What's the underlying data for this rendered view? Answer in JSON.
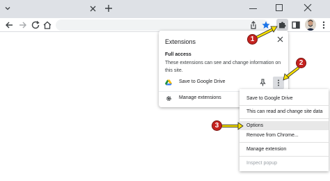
{
  "popup": {
    "title": "Extensions",
    "section_heading": "Full access",
    "description": "These extensions can see and change information on this site.",
    "extension_name": "Save to Google Drive",
    "manage_label": "Manage extensions"
  },
  "context_menu": {
    "items": [
      "Save to Google Drive",
      "This can read and change site data",
      "Options",
      "Remove from Chrome...",
      "Manage extension",
      "Inspect popup"
    ],
    "highlighted": "Options",
    "disabled": "Inspect popup"
  },
  "annotations": {
    "step1": "1",
    "step2": "2",
    "step3": "3",
    "color_marker": "#c5221f",
    "color_arrow": "#f7e000"
  },
  "icons": {
    "tab_chevron": "chevron-down-icon",
    "tab_close": "close-icon",
    "new_tab": "plus-icon",
    "back": "back-arrow-icon",
    "forward": "forward-arrow-icon",
    "reload": "reload-icon",
    "home": "home-icon",
    "share": "share-icon",
    "bookmark": "star-icon",
    "extensions": "puzzle-icon",
    "side_panel": "side-panel-icon",
    "menu": "kebab-menu-icon"
  },
  "colors": {
    "tabstrip": "#dee1e6",
    "star": "#1a73e8",
    "drive_green": "#1e8e3e",
    "drive_yellow": "#fbbc04",
    "drive_blue": "#4285f4"
  }
}
